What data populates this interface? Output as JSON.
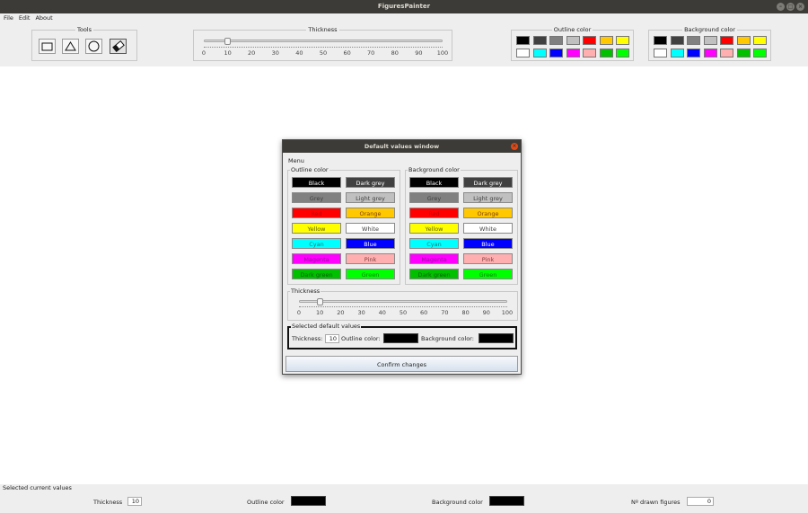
{
  "window": {
    "title": "FiguresPainter"
  },
  "menubar": {
    "items": [
      "File",
      "Edit",
      "About"
    ]
  },
  "toolbar": {
    "tools_title": "Tools",
    "thickness_title": "Thickness",
    "thickness_ticks": [
      "0",
      "10",
      "20",
      "30",
      "40",
      "50",
      "60",
      "70",
      "80",
      "90",
      "100"
    ],
    "thickness_value": 10,
    "outline_title": "Outline color",
    "background_title": "Background color",
    "palette_row1": [
      "#000000",
      "#404040",
      "#808080",
      "#c0c0c0",
      "#ff0000",
      "#ffc800",
      "#ffff00"
    ],
    "palette_row2": [
      "#ffffff",
      "#00ffff",
      "#0000ff",
      "#ff00ff",
      "#ffafaf",
      "#00c000",
      "#00ff00"
    ]
  },
  "dialog": {
    "title": "Default values window",
    "menu_label": "Menu",
    "outline_title": "Outline color",
    "background_title": "Background color",
    "colors": [
      {
        "label": "Black",
        "bg": "#000000",
        "fg": "#ffffff"
      },
      {
        "label": "Dark grey",
        "bg": "#404040",
        "fg": "#ffffff"
      },
      {
        "label": "Grey",
        "bg": "#808080",
        "fg": "#404040"
      },
      {
        "label": "Light grey",
        "bg": "#c0c0c0",
        "fg": "#404040"
      },
      {
        "label": "Red",
        "bg": "#ff0000",
        "fg": "#c00000"
      },
      {
        "label": "Orange",
        "bg": "#ffc800",
        "fg": "#804000"
      },
      {
        "label": "Yellow",
        "bg": "#ffff00",
        "fg": "#606000"
      },
      {
        "label": "White",
        "bg": "#ffffff",
        "fg": "#404040"
      },
      {
        "label": "Cyan",
        "bg": "#00ffff",
        "fg": "#008080"
      },
      {
        "label": "Blue",
        "bg": "#0000ff",
        "fg": "#ffffff"
      },
      {
        "label": "Magenta",
        "bg": "#ff00ff",
        "fg": "#a000a0"
      },
      {
        "label": "Pink",
        "bg": "#ffafaf",
        "fg": "#804040"
      },
      {
        "label": "Dark green",
        "bg": "#00c000",
        "fg": "#006000"
      },
      {
        "label": "Green",
        "bg": "#00ff00",
        "fg": "#008000"
      }
    ],
    "thickness_title": "Thickness",
    "thickness_ticks": [
      "0",
      "10",
      "20",
      "30",
      "40",
      "50",
      "60",
      "70",
      "80",
      "90",
      "100"
    ],
    "thickness_value": 10,
    "selected_title": "Selected default values",
    "thickness_label": "Thickness:",
    "thickness_val": "10",
    "outline_label": "Outline color:",
    "background_label": "Background color:",
    "confirm_label": "Confirm changes"
  },
  "status": {
    "title": "Selected current values",
    "thickness_label": "Thickness",
    "thickness_value": "10",
    "outline_label": "Outline color",
    "background_label": "Background color",
    "figures_label": "Nº drawn figures",
    "figures_value": "0"
  }
}
